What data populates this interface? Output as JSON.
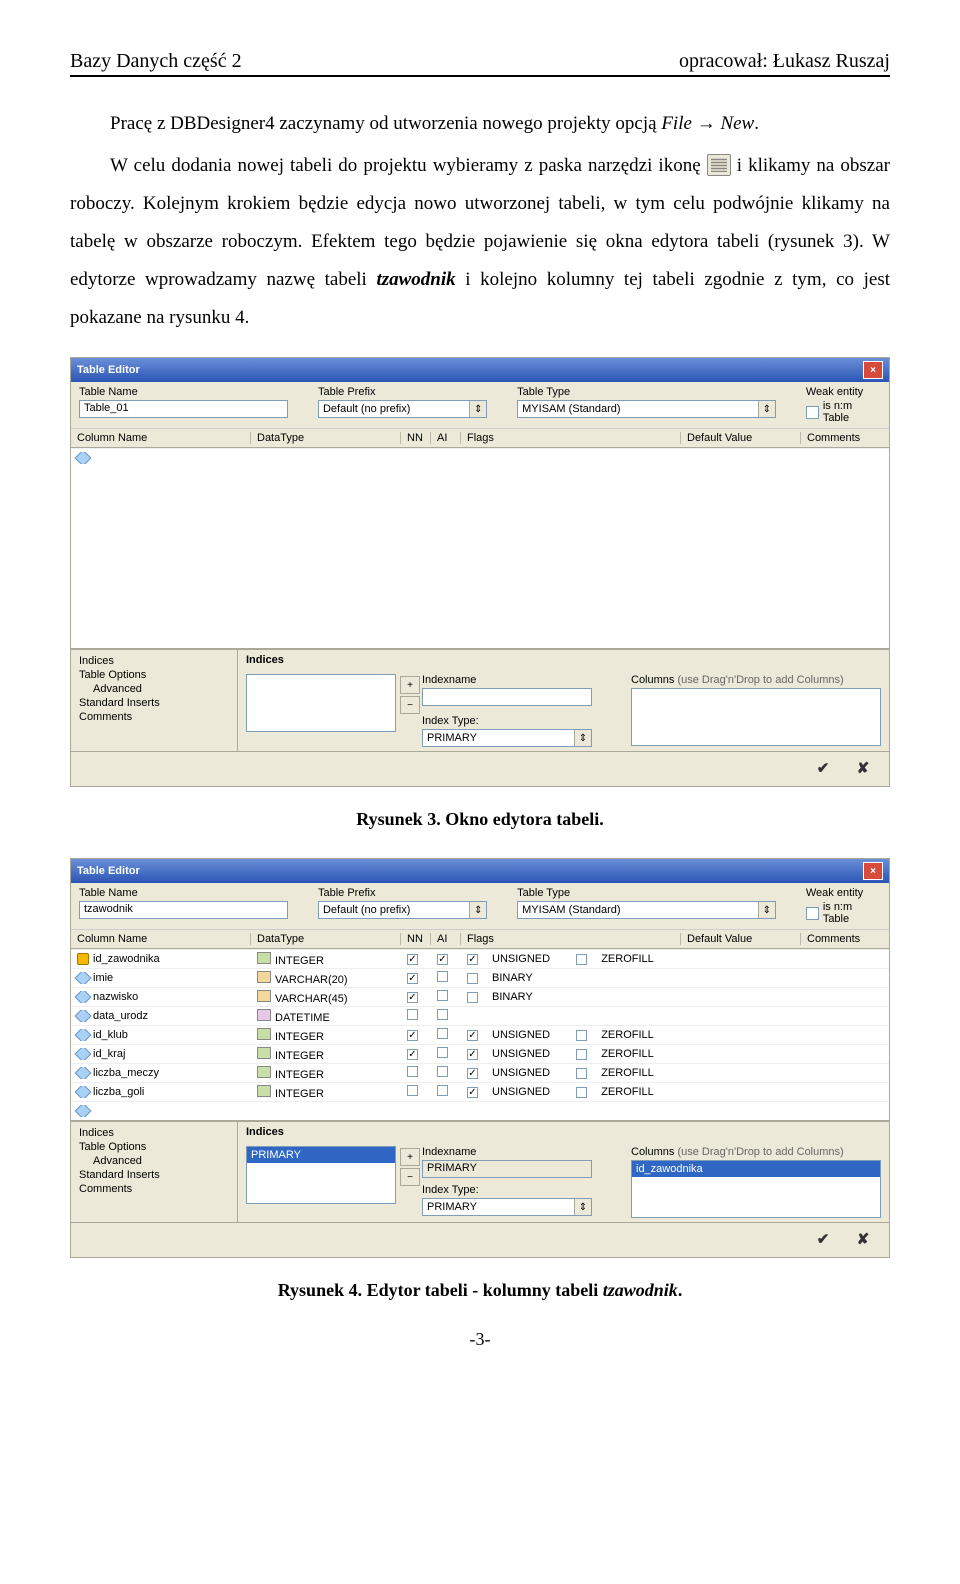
{
  "header": {
    "left": "Bazy Danych część 2",
    "right": "opracował: Łukasz Ruszaj"
  },
  "body": {
    "p1_a": "Pracę z DBDesigner4 zaczynamy od utworzenia nowego projekty opcją ",
    "p1_file": "File",
    "p1_arrow": " → ",
    "p1_new": "New",
    "p1_end": ".",
    "p2_a": "W celu dodania nowej tabeli do projektu wybieramy z paska narzędzi ikonę ",
    "p2_b": " i klikamy na obszar roboczy. Kolejnym krokiem będzie edycja nowo utworzonej tabeli, w tym celu podwójnie klikamy na tabelę w obszarze roboczym. Efektem tego będzie pojawienie się okna edytora tabeli (rysunek 3). W edytorze wprowadzamy nazwę tabeli ",
    "p2_tzawodnik": "tzawodnik",
    "p2_c": " i kolejno kolumny tej tabeli zgodnie z tym, co jest pokazane na rysunku 4."
  },
  "captions": {
    "fig3": "Rysunek 3. Okno edytora tabeli.",
    "fig4": "Rysunek 4. Edytor tabeli - kolumny tabeli ",
    "fig4_it": "tzawodnik",
    "fig4_end": "."
  },
  "editor_common": {
    "title": "Table Editor",
    "labels": {
      "tablename": "Table Name",
      "tableprefix": "Table Prefix",
      "tabletype": "Table Type",
      "weakentity": "Weak entity",
      "isnmtable": "is n:m Table",
      "colname": "Column Name",
      "datatype": "DataType",
      "nn": "NN",
      "ai": "AI",
      "flags_hdr": "Flags",
      "default": "Default Value",
      "comments": "Comments",
      "indices": "Indices",
      "indexname": "Indexname",
      "columns": "Columns",
      "columns_hint": "(use Drag'n'Drop to add Columns)",
      "indextype": "Index Type:",
      "primary": "PRIMARY"
    },
    "prefix_value": "Default (no prefix)",
    "type_value": "MYISAM  (Standard)",
    "tree": {
      "items": [
        "Indices",
        "Table Options",
        "Advanced",
        "Standard Inserts",
        "Comments"
      ]
    },
    "flags": {
      "unsigned": "UNSIGNED",
      "zerofill": "ZEROFILL",
      "binary": "BINARY"
    }
  },
  "fig3data": {
    "tablename": "Table_01",
    "indices": [],
    "index_column": ""
  },
  "fig4data": {
    "tablename": "tzawodnik",
    "columns": [
      {
        "key": true,
        "name": "id_zawodnika",
        "dtype": "INTEGER",
        "nn": true,
        "ai": true,
        "flag_unsigned": true,
        "flag_zerofill": false,
        "flag_binary": null
      },
      {
        "key": false,
        "name": "imie",
        "dtype": "VARCHAR(20)",
        "nn": true,
        "ai": false,
        "flag_unsigned": null,
        "flag_zerofill": null,
        "flag_binary": false
      },
      {
        "key": false,
        "name": "nazwisko",
        "dtype": "VARCHAR(45)",
        "nn": true,
        "ai": false,
        "flag_unsigned": null,
        "flag_zerofill": null,
        "flag_binary": false
      },
      {
        "key": false,
        "name": "data_urodz",
        "dtype": "DATETIME",
        "nn": false,
        "ai": false,
        "flag_unsigned": null,
        "flag_zerofill": null,
        "flag_binary": null
      },
      {
        "key": false,
        "name": "id_klub",
        "dtype": "INTEGER",
        "nn": true,
        "ai": false,
        "flag_unsigned": true,
        "flag_zerofill": false,
        "flag_binary": null
      },
      {
        "key": false,
        "name": "id_kraj",
        "dtype": "INTEGER",
        "nn": true,
        "ai": false,
        "flag_unsigned": true,
        "flag_zerofill": false,
        "flag_binary": null
      },
      {
        "key": false,
        "name": "liczba_meczy",
        "dtype": "INTEGER",
        "nn": false,
        "ai": false,
        "flag_unsigned": true,
        "flag_zerofill": false,
        "flag_binary": null
      },
      {
        "key": false,
        "name": "liczba_goli",
        "dtype": "INTEGER",
        "nn": false,
        "ai": false,
        "flag_unsigned": true,
        "flag_zerofill": false,
        "flag_binary": null
      }
    ],
    "indices": [
      "PRIMARY"
    ],
    "index_column": "id_zawodnika"
  },
  "page_number": "-3-"
}
